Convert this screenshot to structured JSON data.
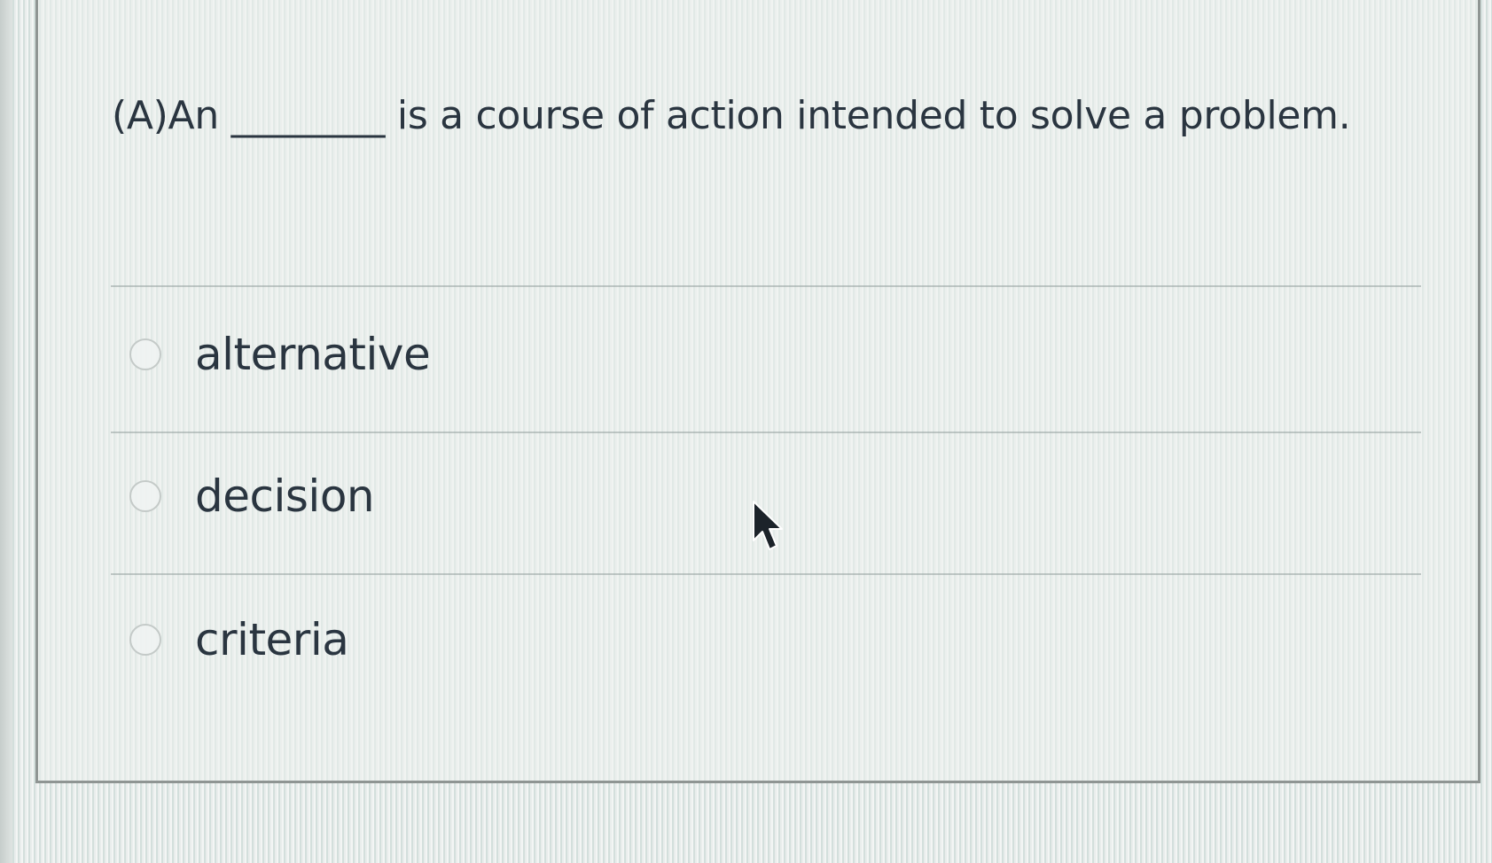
{
  "question": {
    "text": "(A)An ________ is a course of action intended to solve a problem."
  },
  "options": [
    {
      "label": "alternative",
      "selected": false
    },
    {
      "label": "decision",
      "selected": false
    },
    {
      "label": "criteria",
      "selected": false
    }
  ],
  "icons": {
    "radio": "radio-unchecked-icon",
    "cursor": "mouse-pointer-icon"
  },
  "colors": {
    "text": "#2a3540",
    "border": "#8f9593",
    "radio_border": "#c4cac8"
  }
}
